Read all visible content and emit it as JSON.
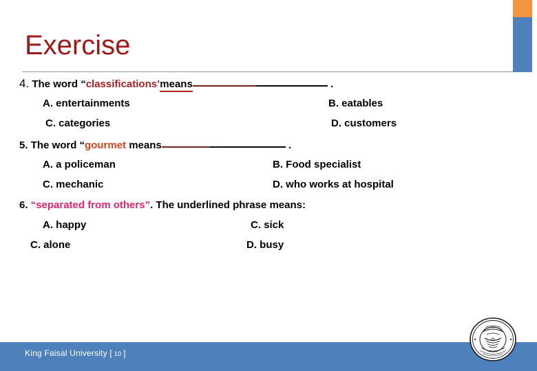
{
  "slide": {
    "title": "Exercise",
    "accent": {
      "orange": "#F4943F",
      "blue": "#4E80BC",
      "title_color": "#9E1A1A",
      "rule_color": "#8496A8"
    }
  },
  "questions": [
    {
      "number": "4.",
      "prefix": "The word “",
      "keyword": "classifications’",
      "keyword_color": "#A81F20",
      "suffix": "means",
      "blank": true,
      "terminator": ".",
      "options": [
        {
          "label": "A. entertainments"
        },
        {
          "label": "B. eatables"
        },
        {
          "label": "C.  categories"
        },
        {
          "label": "D. customers"
        }
      ]
    },
    {
      "number": "5.",
      "prefix": "The word “",
      "keyword": "gourmet",
      "keyword_color": "#D2451E",
      "suffix": "means",
      "blank": true,
      "terminator": ".",
      "options": [
        {
          "label": "A. a policeman"
        },
        {
          "label": "B.  Food specialist"
        },
        {
          "label": "C. mechanic"
        },
        {
          "label": "D. who works at hospital"
        }
      ]
    },
    {
      "number": "6.",
      "prefix": "",
      "keyword": "“separated from others”",
      "keyword_color": "#E2236E",
      "suffix": ". The underlined phrase means:",
      "blank": false,
      "terminator": "",
      "options": [
        {
          "label": "A. happy"
        },
        {
          "label": "C. sick"
        },
        {
          "label": "C. alone"
        },
        {
          "label": "D. busy"
        }
      ]
    }
  ],
  "footer": {
    "institution": "King Faisal University",
    "bracket_open": "[",
    "page_number": "10",
    "bracket_close": "]",
    "band_color": "#4E80BC",
    "text_color": "#FFFFFF"
  },
  "logo": {
    "name": "king-faisal-university-seal",
    "arabic_top": "جامعة الملك فيصل",
    "latin_bottom": "KING FAISAL UNIVERSITY"
  }
}
